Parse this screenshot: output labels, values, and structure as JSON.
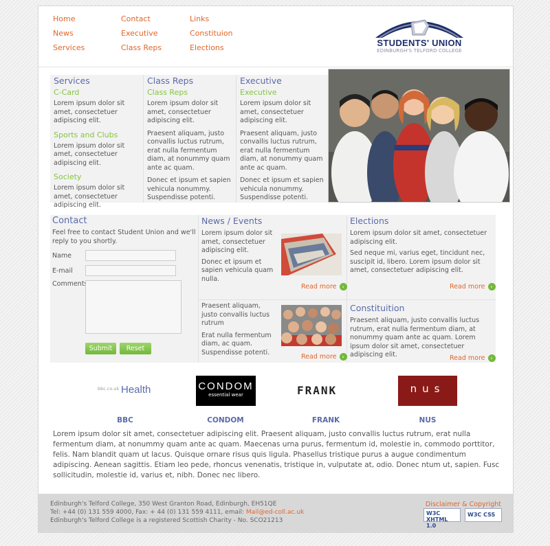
{
  "nav": {
    "col1": [
      "Home",
      "News",
      "Services"
    ],
    "col2": [
      "Contact",
      "Executive",
      "Class Reps"
    ],
    "col3": [
      "Links",
      "Constituion",
      "Elections"
    ]
  },
  "logo": {
    "title": "STUDENTS' UNION",
    "subtitle": "EDINBURGH'S TELFORD COLLEGE"
  },
  "info": {
    "services": {
      "title": "Services",
      "items": [
        {
          "heading": "C-Card",
          "text": "Lorem ipsum dolor sit amet, consectetuer adipiscing elit."
        },
        {
          "heading": "Sports and Clubs",
          "text": "Lorem ipsum dolor sit amet, consectetuer adipiscing elit."
        },
        {
          "heading": "Society",
          "text": "Lorem ipsum dolor sit amet, consectetuer adipiscing elit."
        }
      ]
    },
    "classreps": {
      "title": "Class Reps",
      "sub": "Class Reps",
      "p1": "Lorem ipsum dolor sit amet, consectetuer adipiscing elit.",
      "p2": "Praesent aliquam, justo convallis luctus rutrum, erat nulla fermentum diam, at nonummy quam ante ac quam.",
      "p3": "Donec et ipsum et sapien vehicula nonummy. Suspendisse potenti."
    },
    "executive": {
      "title": "Executive",
      "sub": "Executive",
      "p1": "Lorem ipsum dolor sit amet, consectetuer adipiscing elit.",
      "p2": "Praesent aliquam, justo convallis luctus rutrum, erat nulla fermentum diam, at nonummy quam ante ac quam.",
      "p3": "Donec et ipsum et sapien vehicula nonummy. Suspendisse potenti."
    }
  },
  "contact": {
    "title": "Contact",
    "intro": "Feel free to contact Student Union and we'll reply to you shortly.",
    "name_label": "Name",
    "email_label": "E-mail",
    "comments_label": "Comments",
    "submit": "Submit",
    "reset": "Reset"
  },
  "news": {
    "title": "News / Events",
    "item1": {
      "p1": "Lorem ipsum dolor sit amet, consectetuer adipiscing elit.",
      "p2": "Donec et ipsum et sapien vehicula quam nulla."
    },
    "item2": {
      "p1": "Praesent aliquam, justo convallis luctus rutrum",
      "p2": "Erat nulla fermentum diam, ac quam. Suspendisse potenti."
    },
    "read_more": "Read more"
  },
  "elections": {
    "title": "Elections",
    "p1": "Lorem ipsum dolor sit amet, consectetuer adipiscing elit.",
    "p2": "Sed neque mi, varius eget, tincidunt nec, suscipit id, libero. Lorem ipsum dolor sit amet, consectetuer adipiscing elit.",
    "read_more": "Read more"
  },
  "constitution": {
    "title": "Constituition",
    "p1": "Praesent aliquam, justo convallis luctus rutrum, erat nulla fermentum diam, at nonummy quam ante ac quam. Lorem ipsum dolor sit amet, consectetuer adipiscing elit.",
    "read_more": "Read more"
  },
  "partners": {
    "bbc_logo_small": "bbc.co.uk",
    "bbc_logo": "Health",
    "condom_logo": "CONDOM",
    "condom_logo_sub": "essential wear",
    "frank_logo": "FRANK",
    "nus_logo": "nus",
    "labels": [
      "BBC",
      "CONDOM",
      "FRANK",
      "NUS"
    ]
  },
  "body_text": "Lorem ipsum dolor sit amet, consectetuer adipiscing elit. Praesent aliquam, justo convallis luctus rutrum, erat nulla fermentum diam, at nonummy quam ante ac quam. Maecenas urna purus, fermentum id, molestie in, commodo porttitor, felis. Nam blandit quam ut lacus. Quisque ornare risus quis ligula. Phasellus tristique purus a augue condimentum adipiscing. Aenean sagittis. Etiam leo pede, rhoncus venenatis, tristique in, vulputate at, odio. Donec ntum ut, sapien. Fusc sollicitudin, molestie id, varius et, nibh. Donec nec libero.",
  "footer": {
    "line1": "Edinburgh's Telford College, 350 West Granton Road, Edinburgh, EH51QE",
    "line2": "Tel: +44 (0) 131 559 4000, Fax: + 44 (0) 131 559 4111, email:",
    "email": "Mail@ed-coll.ac.uk",
    "line3": "Edinburgh's Telford College is a registered Scottish Charity - No. SCO21213",
    "disclaimer": "Disclaimer & Copyright",
    "badge1": "W3C XHTML 1.0",
    "badge2": "W3C CSS"
  }
}
